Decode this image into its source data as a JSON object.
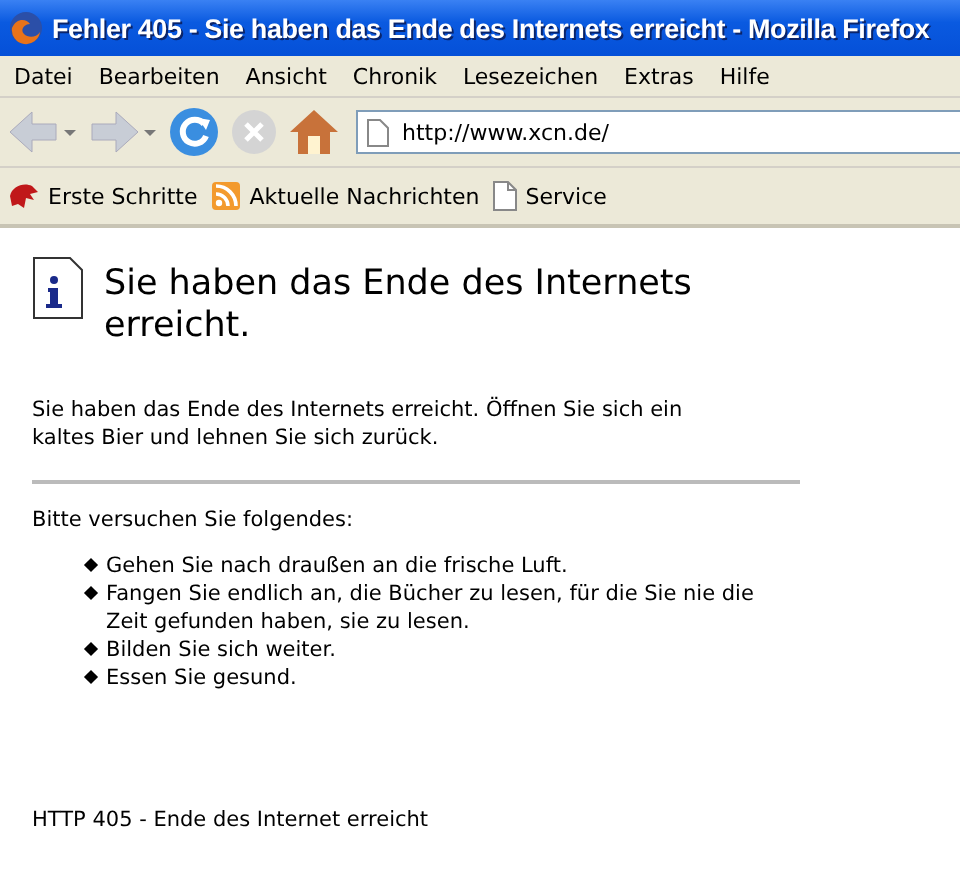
{
  "window": {
    "title": "Fehler 405 - Sie haben das Ende des Internets erreicht - Mozilla Firefox"
  },
  "menu": [
    "Datei",
    "Bearbeiten",
    "Ansicht",
    "Chronik",
    "Lesezeichen",
    "Extras",
    "Hilfe"
  ],
  "toolbar": {
    "back_disabled": true,
    "forward_disabled": true,
    "address": "http://www.xcn.de/"
  },
  "bookmarks": [
    {
      "label": "Erste Schritte",
      "kind": "start"
    },
    {
      "label": "Aktuelle Nachrichten",
      "kind": "feed"
    },
    {
      "label": "Service",
      "kind": "page"
    }
  ],
  "page": {
    "heading": "Sie haben das Ende des Internets erreicht.",
    "intro": "Sie haben das Ende des Internets erreicht. Öffnen Sie sich ein kaltes Bier und lehnen Sie sich zurück.",
    "suggestions_title": "Bitte versuchen Sie folgendes:",
    "suggestions": [
      "Gehen Sie nach draußen an die frische Luft.",
      "Fangen Sie endlich an, die Bücher zu lesen, für die Sie nie die Zeit gefunden haben, sie zu lesen.",
      "Bilden Sie sich weiter.",
      "Essen Sie gesund."
    ],
    "footer": "HTTP 405 - Ende des Internet erreicht"
  }
}
